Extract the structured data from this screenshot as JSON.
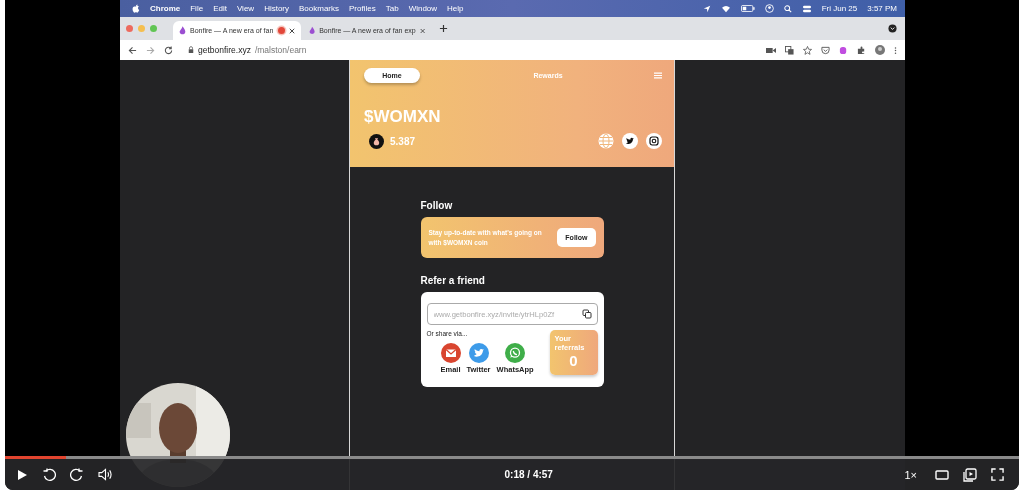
{
  "menu_bar": {
    "app": "Chrome",
    "items": [
      "File",
      "Edit",
      "View",
      "History",
      "Bookmarks",
      "Profiles",
      "Tab",
      "Window",
      "Help"
    ],
    "date": "Fri Jun 25",
    "time": "3:57 PM"
  },
  "tabs": [
    {
      "title": "Bonfire — A new era of fan",
      "selected": true,
      "recording": true
    },
    {
      "title": "Bonfire — A new era of fan exp",
      "selected": false,
      "recording": false
    }
  ],
  "address": {
    "domain": "getbonfire.xyz",
    "path": "/malston/earn"
  },
  "app": {
    "nav": [
      {
        "label": "Home",
        "selected": true
      },
      {
        "label": "Rewards",
        "selected": false
      }
    ],
    "coin": "$WOMXN",
    "balance": "5.387",
    "follow": {
      "heading": "Follow",
      "text": "Stay up-to-date with what's going on with $WOMXN coin",
      "button": "Follow"
    },
    "refer": {
      "heading": "Refer a friend",
      "link": {
        "placeholder": "www.getbonfire.xyz/invite/ytrHLp0Zf"
      },
      "share_label": "Or share via...",
      "share": [
        {
          "kind": "email",
          "label": "Email"
        },
        {
          "kind": "twitter",
          "label": "Twitter"
        },
        {
          "kind": "whatsapp",
          "label": "WhatsApp"
        }
      ],
      "referrals_label": "Your referrals",
      "referrals": "0"
    }
  },
  "player": {
    "time": "0:18 / 4:57",
    "speed": "1×",
    "progress": {
      "level": 0.06
    }
  }
}
